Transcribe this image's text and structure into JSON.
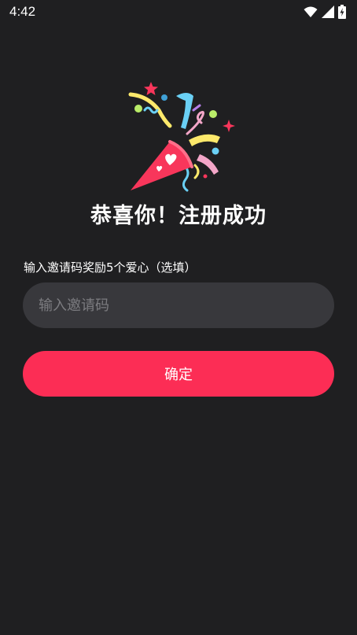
{
  "status_bar": {
    "time": "4:42",
    "icons": [
      "wifi-icon",
      "signal-icon",
      "battery-charging-icon"
    ]
  },
  "illustration": {
    "icon": "party-popper-icon",
    "colors": {
      "cone": "#f8365b",
      "heart": "#ffffff",
      "yellow": "#fde96b",
      "blue": "#6ad0f5",
      "green": "#b9ec68",
      "pink": "#f3a6c8",
      "purple": "#b57ee8",
      "navy": "#3fa0d6"
    }
  },
  "title": "恭喜你！注册成功",
  "invite": {
    "label": "输入邀请码奖励5个爱心（选填）",
    "placeholder": "输入邀请码",
    "value": ""
  },
  "confirm_button": {
    "label": "确定"
  },
  "colors": {
    "background": "#1f1f21",
    "input_background": "#38383c",
    "accent": "#fc2d55",
    "text": "#ffffff",
    "placeholder": "#7c7c80"
  }
}
